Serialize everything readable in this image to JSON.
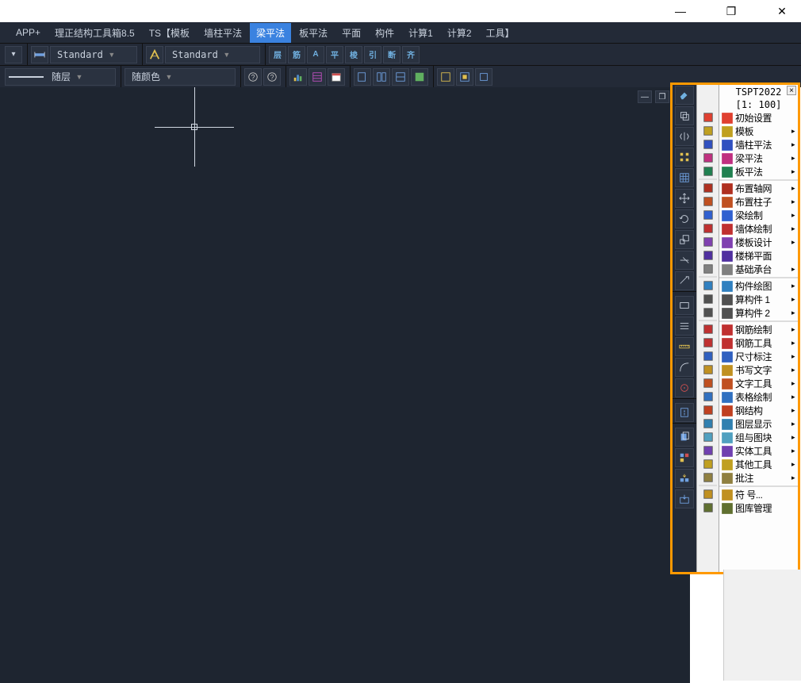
{
  "title_buttons": {
    "min": "—",
    "max": "❐",
    "close": "✕"
  },
  "menubar": [
    {
      "label": "APP+",
      "active": false
    },
    {
      "label": "理正结构工具箱8.5",
      "active": false
    },
    {
      "label": "TS【模板",
      "active": false
    },
    {
      "label": "墙柱平法",
      "active": false
    },
    {
      "label": "梁平法",
      "active": true
    },
    {
      "label": "板平法",
      "active": false
    },
    {
      "label": "平面",
      "active": false
    },
    {
      "label": "构件",
      "active": false
    },
    {
      "label": "计算1",
      "active": false
    },
    {
      "label": "计算2",
      "active": false
    },
    {
      "label": "工具】",
      "active": false
    }
  ],
  "toolbar1": {
    "style1": "Standard",
    "style2": "Standard",
    "ribbon_buttons": [
      "层",
      "筋",
      "A",
      "平",
      "梭",
      "引",
      "断",
      "齐"
    ]
  },
  "toolbar2": {
    "layer_label": "随层",
    "color_label": "随颜色"
  },
  "side_panel": {
    "title": "TSPT2022",
    "scale": "[1: 100]",
    "items": [
      {
        "label": "初始设置",
        "arrow": false,
        "color": "#e04030"
      },
      {
        "label": "模板",
        "arrow": true,
        "color": "#c0a020"
      },
      {
        "label": "墙柱平法",
        "arrow": true,
        "color": "#3050c0"
      },
      {
        "label": "梁平法",
        "arrow": true,
        "color": "#c03080"
      },
      {
        "label": "板平法",
        "arrow": true,
        "color": "#208050"
      },
      {
        "sep": true
      },
      {
        "label": "布置轴网",
        "arrow": true,
        "color": "#b03020"
      },
      {
        "label": "布置柱子",
        "arrow": true,
        "color": "#c05020"
      },
      {
        "label": "梁绘制",
        "arrow": true,
        "color": "#3060d0"
      },
      {
        "label": "墙体绘制",
        "arrow": true,
        "color": "#c03030"
      },
      {
        "label": "楼板设计",
        "arrow": true,
        "color": "#8040b0"
      },
      {
        "label": "楼梯平面",
        "arrow": false,
        "color": "#5030a0"
      },
      {
        "label": "基础承台",
        "arrow": true,
        "color": "#808080"
      },
      {
        "sep": true
      },
      {
        "label": "构件绘图",
        "arrow": true,
        "color": "#3080c0"
      },
      {
        "label": "算构件 1",
        "arrow": true,
        "color": "#505050"
      },
      {
        "label": "算构件 2",
        "arrow": true,
        "color": "#505050"
      },
      {
        "sep": true
      },
      {
        "label": "钢筋绘制",
        "arrow": true,
        "color": "#c03030"
      },
      {
        "label": "钢筋工具",
        "arrow": true,
        "color": "#c03030"
      },
      {
        "label": "尺寸标注",
        "arrow": true,
        "color": "#3060c0"
      },
      {
        "label": "书写文字",
        "arrow": true,
        "color": "#c09020"
      },
      {
        "label": "文字工具",
        "arrow": true,
        "color": "#c05020"
      },
      {
        "label": "表格绘制",
        "arrow": true,
        "color": "#3070c0"
      },
      {
        "label": "钢结构",
        "arrow": true,
        "color": "#c04020"
      },
      {
        "label": "图层显示",
        "arrow": true,
        "color": "#3080b0"
      },
      {
        "label": "组与图块",
        "arrow": true,
        "color": "#50a0c0"
      },
      {
        "label": "实体工具",
        "arrow": true,
        "color": "#7040b0"
      },
      {
        "label": "其他工具",
        "arrow": true,
        "color": "#c0a020"
      },
      {
        "label": "批注",
        "arrow": true,
        "color": "#908040"
      },
      {
        "sep": true
      },
      {
        "label": "符  号...",
        "arrow": false,
        "color": "#c09020"
      },
      {
        "label": "图库管理",
        "arrow": false,
        "color": "#607030"
      }
    ]
  }
}
